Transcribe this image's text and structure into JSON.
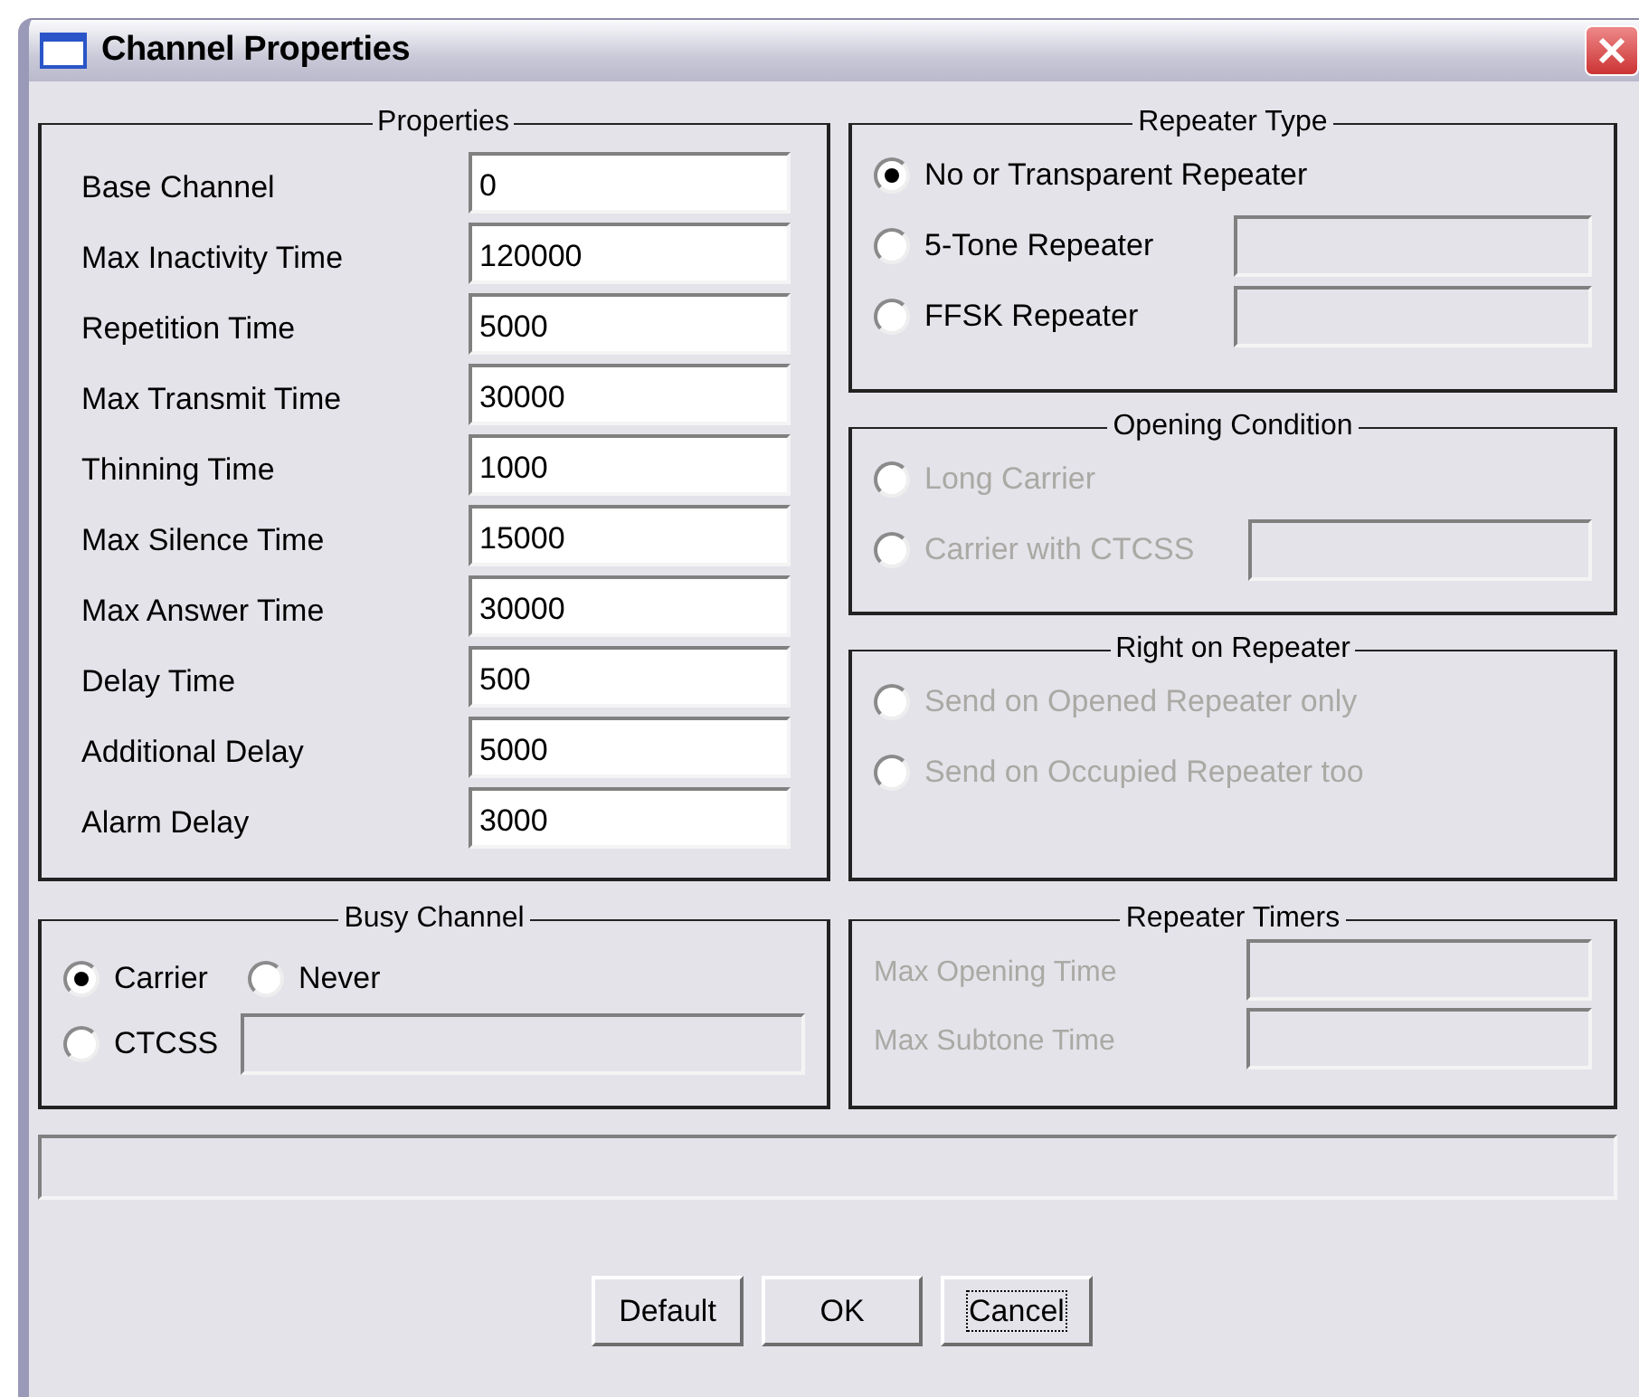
{
  "window": {
    "title": "Channel Properties"
  },
  "properties": {
    "title": "Properties",
    "fields": [
      {
        "label": "Base Channel",
        "value": "0"
      },
      {
        "label": "Max Inactivity Time",
        "value": "120000"
      },
      {
        "label": "Repetition Time",
        "value": "5000"
      },
      {
        "label": "Max Transmit Time",
        "value": "30000"
      },
      {
        "label": "Thinning Time",
        "value": "1000"
      },
      {
        "label": "Max Silence Time",
        "value": "15000"
      },
      {
        "label": "Max Answer Time",
        "value": "30000"
      },
      {
        "label": "Delay Time",
        "value": "500"
      },
      {
        "label": "Additional Delay",
        "value": "5000"
      },
      {
        "label": "Alarm Delay",
        "value": "3000"
      }
    ]
  },
  "repeater_type": {
    "title": "Repeater Type",
    "options": [
      {
        "label": "No or Transparent Repeater",
        "kind": "plain",
        "selected": true,
        "disabled": false
      },
      {
        "label": "5-Tone Repeater",
        "kind": "with_field",
        "selected": false,
        "disabled": false
      },
      {
        "label": "FFSK Repeater",
        "kind": "with_field",
        "selected": false,
        "disabled": false
      }
    ]
  },
  "opening_condition": {
    "title": "Opening Condition",
    "options": [
      {
        "label": "Long Carrier",
        "kind": "plain",
        "selected": false,
        "disabled": true
      },
      {
        "label": "Carrier with CTCSS",
        "kind": "with_field",
        "selected": false,
        "disabled": true
      }
    ]
  },
  "right_on_repeater": {
    "title": "Right on Repeater",
    "options": [
      {
        "label": "Send on Opened Repeater only",
        "selected": false,
        "disabled": true
      },
      {
        "label": "Send on Occupied Repeater too",
        "selected": false,
        "disabled": true
      }
    ]
  },
  "busy_channel": {
    "title": "Busy Channel",
    "options": [
      {
        "label": "Carrier",
        "kind": "plain",
        "selected": true,
        "disabled": false
      },
      {
        "label": "Never",
        "kind": "plain",
        "selected": false,
        "disabled": false
      },
      {
        "label": "CTCSS",
        "kind": "with_field",
        "selected": false,
        "disabled": false
      }
    ]
  },
  "repeater_timers": {
    "title": "Repeater Timers",
    "fields": [
      {
        "label": "Max Opening Time",
        "disabled": true
      },
      {
        "label": "Max Subtone Time",
        "disabled": true
      }
    ]
  },
  "buttons": [
    {
      "label": "Default",
      "focused": false
    },
    {
      "label": "OK",
      "focused": false
    },
    {
      "label": "Cancel",
      "focused": true
    }
  ]
}
